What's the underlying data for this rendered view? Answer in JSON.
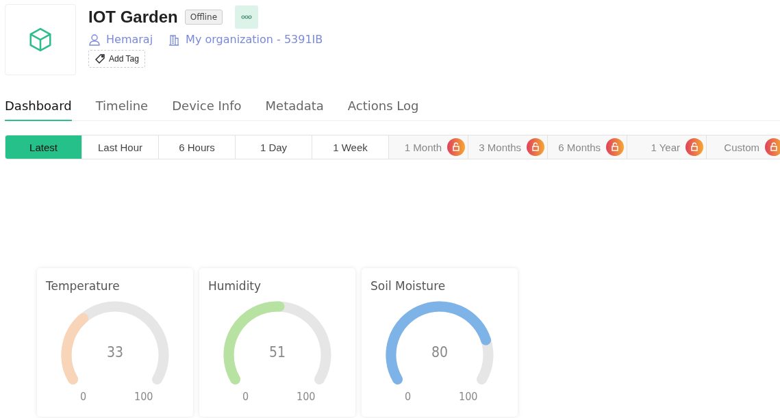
{
  "device": {
    "title": "IOT Garden",
    "status": "Offline",
    "owner": "Hemaraj",
    "organization": "My organization - 5391IB",
    "add_tag": "Add Tag"
  },
  "tabs": [
    {
      "label": "Dashboard",
      "selected": true
    },
    {
      "label": "Timeline",
      "selected": false
    },
    {
      "label": "Device Info",
      "selected": false
    },
    {
      "label": "Metadata",
      "selected": false
    },
    {
      "label": "Actions Log",
      "selected": false
    }
  ],
  "ranges": [
    {
      "label": "Latest",
      "selected": true,
      "locked": false
    },
    {
      "label": "Last Hour",
      "selected": false,
      "locked": false
    },
    {
      "label": "6 Hours",
      "selected": false,
      "locked": false
    },
    {
      "label": "1 Day",
      "selected": false,
      "locked": false
    },
    {
      "label": "1 Week",
      "selected": false,
      "locked": false
    },
    {
      "label": "1 Month",
      "selected": false,
      "locked": true
    },
    {
      "label": "3 Months",
      "selected": false,
      "locked": true
    },
    {
      "label": "6 Months",
      "selected": false,
      "locked": true
    },
    {
      "label": "1 Year",
      "selected": false,
      "locked": true
    },
    {
      "label": "Custom",
      "selected": false,
      "locked": true
    }
  ],
  "gauges": [
    {
      "title": "Temperature",
      "value": "33",
      "color": "#f8d4b8",
      "min": "0",
      "max": "100"
    },
    {
      "title": "Humidity",
      "value": "51",
      "color": "#b8e2a2",
      "min": "0",
      "max": "100"
    },
    {
      "title": "Soil Moisture",
      "value": "80",
      "color": "#7eb3e8",
      "min": "0",
      "max": "100"
    }
  ]
}
